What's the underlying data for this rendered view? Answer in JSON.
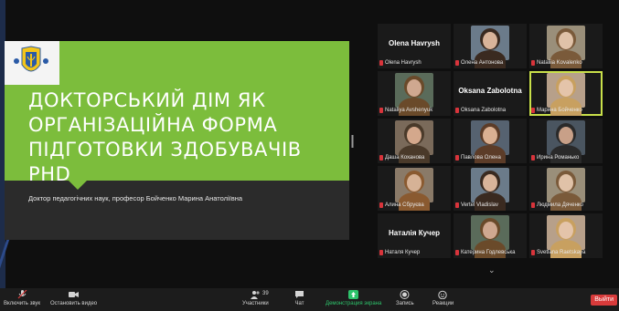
{
  "slide": {
    "title": "ДОКТОРСЬКИЙ ДІМ ЯК ОРГАНІЗАЦІЙНА ФОРМА ПІДГОТОВКИ ЗДОБУВАЧІВ PHD",
    "subtitle": "Доктор педагогічних наук, професор Бойченко Марина Анатоліївна",
    "green": "#7cbd3c"
  },
  "participants": [
    {
      "display": "Olena Havrysh",
      "label": "Olena Havrysh",
      "video": false
    },
    {
      "display": "",
      "label": "Олена Антонова",
      "video": true
    },
    {
      "display": "",
      "label": "Nataliia Kovalenko",
      "video": true
    },
    {
      "display": "",
      "label": "Nataliya Avshenyuk",
      "video": true
    },
    {
      "display": "Oksana Zabolotna",
      "label": "Oksana Zabolotna",
      "video": false
    },
    {
      "display": "",
      "label": "Марина Бойченко",
      "video": true,
      "active": true
    },
    {
      "display": "",
      "label": "Даша Коханова",
      "video": true
    },
    {
      "display": "",
      "label": "Павлова Олена",
      "video": true
    },
    {
      "display": "",
      "label": "Ирина Романько",
      "video": true
    },
    {
      "display": "",
      "label": "Алина Сбруєва",
      "video": true
    },
    {
      "display": "",
      "label": "Vertel Vladislav",
      "video": true
    },
    {
      "display": "",
      "label": "Людмила Дяченко",
      "video": true
    },
    {
      "display": "Наталія Кучер",
      "label": "Наталя Кучер",
      "video": false
    },
    {
      "display": "",
      "label": "Катерина Годлевська",
      "video": true
    },
    {
      "display": "",
      "label": "Svetlana Raetskaya",
      "video": true
    }
  ],
  "toolbar": {
    "mute": "Включить звук",
    "video": "Остановить видео",
    "participants_count": "39",
    "participants": "Участники",
    "chat": "Чат",
    "share": "Демонстрация экрана",
    "record": "Запись",
    "reactions": "Реакции",
    "leave": "Выйти"
  },
  "icons": {
    "mic": "mic-muted-icon",
    "camera": "camera-icon",
    "people": "participants-icon",
    "chat": "chat-icon",
    "share": "share-screen-icon",
    "record": "record-icon",
    "reactions": "reactions-icon",
    "scroll": "chevron-down-icon"
  }
}
